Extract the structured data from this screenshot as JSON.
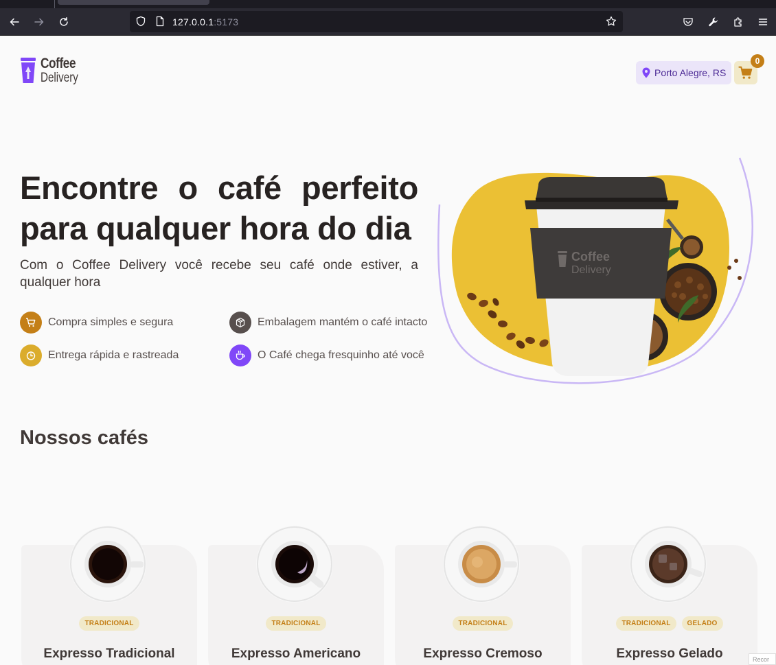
{
  "browser": {
    "url_host": "127.0.0.1",
    "url_port": ":5173"
  },
  "header": {
    "logo_line1": "Coffee",
    "logo_line2": "Delivery",
    "location": "Porto Alegre, RS",
    "cart_count": "0"
  },
  "hero": {
    "title": "Encontre o café perfeito para qualquer hora do dia",
    "subtitle": "Com o Coffee Delivery você recebe seu café onde estiver, a qualquer hora",
    "features": [
      {
        "label": "Compra simples e segura",
        "icon": "shopping-cart-icon",
        "color": "#c47f17"
      },
      {
        "label": "Embalagem mantém o café intacto",
        "icon": "package-icon",
        "color": "#574f4d"
      },
      {
        "label": "Entrega rápida e rastreada",
        "icon": "timer-icon",
        "color": "#dbac2c"
      },
      {
        "label": "O Café chega fresquinho até você",
        "icon": "coffee-icon",
        "color": "#8047f8"
      }
    ],
    "art_cup_logo_line1": "Coffee",
    "art_cup_logo_line2": "Delivery"
  },
  "catalog": {
    "title": "Nossos cafés",
    "items": [
      {
        "name": "Expresso Tradicional",
        "tags": [
          "TRADICIONAL"
        ]
      },
      {
        "name": "Expresso Americano",
        "tags": [
          "TRADICIONAL"
        ]
      },
      {
        "name": "Expresso Cremoso",
        "tags": [
          "TRADICIONAL"
        ]
      },
      {
        "name": "Expresso Gelado",
        "tags": [
          "TRADICIONAL",
          "GELADO"
        ]
      }
    ]
  },
  "overlay": {
    "recorder_label": "Recor"
  },
  "colors": {
    "yellow_dark": "#c47f17",
    "yellow": "#dbac2c",
    "purple": "#8047f8",
    "purple_dark": "#4b2995",
    "background": "#fafafa"
  }
}
